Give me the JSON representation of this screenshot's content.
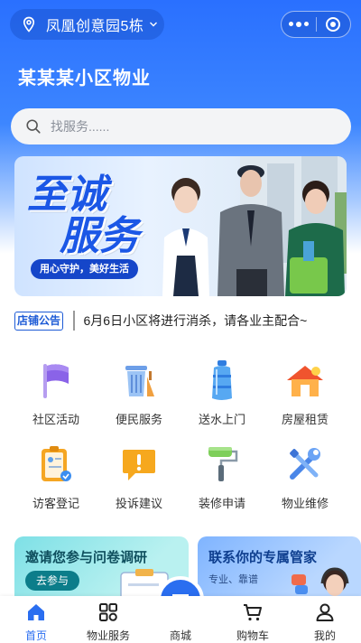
{
  "header": {
    "location": "凤凰创意园5栋",
    "title": "某某某小区物业"
  },
  "search": {
    "placeholder": "找服务......"
  },
  "banner": {
    "title_line1": "至诚",
    "title_line2": "服务",
    "slogan": "用心守护，美好生活"
  },
  "notice": {
    "tag": "店铺公告",
    "text": "6月6日小区将进行消杀，请各业主配合~"
  },
  "services": [
    {
      "label": "社区活动",
      "icon": "flag-icon"
    },
    {
      "label": "便民服务",
      "icon": "trash-bin-icon"
    },
    {
      "label": "送水上门",
      "icon": "water-bottle-icon"
    },
    {
      "label": "房屋租赁",
      "icon": "house-icon"
    },
    {
      "label": "访客登记",
      "icon": "clipboard-icon"
    },
    {
      "label": "投诉建议",
      "icon": "alert-icon"
    },
    {
      "label": "装修申请",
      "icon": "paint-roller-icon"
    },
    {
      "label": "物业维修",
      "icon": "tools-icon"
    }
  ],
  "cards": {
    "survey": {
      "title": "邀请您参与问卷调研",
      "button": "去参与"
    },
    "butler": {
      "title": "联系你的专属管家",
      "subtitle": "专业、靠谱"
    }
  },
  "tabbar": {
    "items": [
      {
        "label": "首页",
        "active": true
      },
      {
        "label": "物业服务",
        "active": false
      },
      {
        "label": "商城",
        "active": false
      },
      {
        "label": "购物车",
        "active": false
      },
      {
        "label": "我的",
        "active": false
      }
    ]
  },
  "colors": {
    "primary": "#2a6ef0",
    "hero_top": "#2a70ff",
    "banner_text": "#1b57e6"
  }
}
